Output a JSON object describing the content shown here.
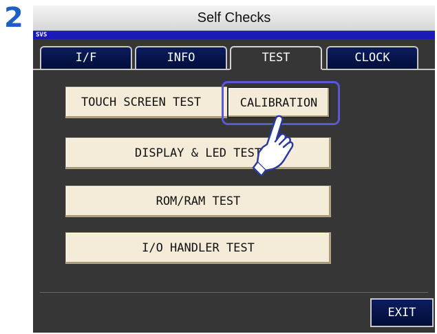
{
  "step_number": "2",
  "window": {
    "title": "Self Checks",
    "status_code": "SVS"
  },
  "tabs": [
    {
      "label": "I/F",
      "active": false
    },
    {
      "label": "INFO",
      "active": false
    },
    {
      "label": "TEST",
      "active": true
    },
    {
      "label": "CLOCK",
      "active": false
    }
  ],
  "tests": {
    "touch_screen": "TOUCH SCREEN TEST",
    "calibration": "CALIBRATION",
    "display_led": "DISPLAY & LED TEST",
    "rom_ram": "ROM/RAM TEST",
    "io_handler": "I/O HANDLER TEST"
  },
  "footer": {
    "exit_label": "EXIT"
  },
  "colors": {
    "step_number": "#1e5fc4",
    "status_bar": "#1a1ab8",
    "tab_inactive": "#0b1c5e",
    "screen_bg": "#363636",
    "button_bg": "#f5ebd9",
    "highlight_ring": "#5a5ad8"
  },
  "pointer_icon": "hand-pointer-icon"
}
